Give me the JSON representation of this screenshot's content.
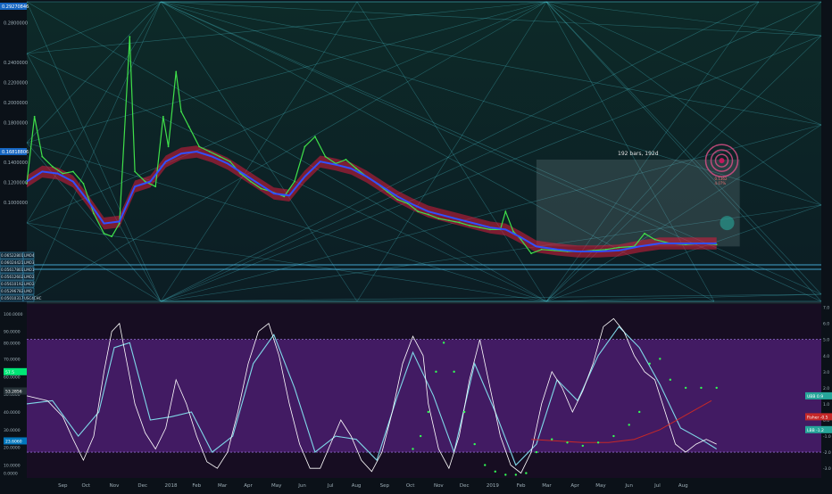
{
  "chart_data": [
    {
      "type": "line",
      "panel": "price",
      "ylim": [
        0.0,
        0.3
      ],
      "x_range": [
        0,
        300
      ],
      "price_tags": {
        "top_label": "0.29270846",
        "mid_label": "0.16818806",
        "low_labels": [
          {
            "value": 0.0652,
            "text": "0.06522801"
          },
          {
            "value": 0.0602,
            "text": "0.06024421"
          },
          {
            "value": 0.0561,
            "text": "0.05617801"
          },
          {
            "value": 0.0525,
            "text": "0.05612602"
          },
          {
            "value": 0.0488,
            "text": "0.05610192"
          },
          {
            "value": 0.0452,
            "text": "0.05296782"
          },
          {
            "value": 0.0405,
            "text": "0.05010317"
          }
        ],
        "low_tags": [
          "LMO4",
          "LMO3",
          "LMO1",
          "LMO2",
          "LMO2",
          "LMO",
          "USC4CHC"
        ]
      },
      "yaxis_labels": [
        {
          "value": 0.28,
          "text": "0.2800000"
        },
        {
          "value": 0.24,
          "text": "0.2400000"
        },
        {
          "value": 0.22,
          "text": "0.2200000"
        },
        {
          "value": 0.2,
          "text": "0.2000000"
        },
        {
          "value": 0.18,
          "text": "0.1800000"
        },
        {
          "value": 0.14,
          "text": "0.1400000"
        },
        {
          "value": 0.12,
          "text": "0.1200000"
        },
        {
          "value": 0.1,
          "text": "0.1000000"
        }
      ],
      "measure_box": {
        "x0": 198,
        "x1": 277,
        "y0": 0.055,
        "y1": 0.142,
        "label": "192 bars, 192d"
      },
      "target_circle": {
        "x": 270,
        "y": 0.141,
        "label1": "0.1362",
        "label2": "4.07%"
      },
      "price_series": [
        [
          0,
          0.118
        ],
        [
          3,
          0.185
        ],
        [
          6,
          0.145
        ],
        [
          10,
          0.135
        ],
        [
          14,
          0.128
        ],
        [
          18,
          0.13
        ],
        [
          22,
          0.118
        ],
        [
          26,
          0.088
        ],
        [
          30,
          0.068
        ],
        [
          33,
          0.065
        ],
        [
          36,
          0.078
        ],
        [
          40,
          0.265
        ],
        [
          42,
          0.13
        ],
        [
          46,
          0.12
        ],
        [
          50,
          0.115
        ],
        [
          53,
          0.185
        ],
        [
          55,
          0.155
        ],
        [
          58,
          0.23
        ],
        [
          60,
          0.19
        ],
        [
          63,
          0.175
        ],
        [
          67,
          0.155
        ],
        [
          71,
          0.15
        ],
        [
          75,
          0.145
        ],
        [
          79,
          0.14
        ],
        [
          83,
          0.128
        ],
        [
          87,
          0.12
        ],
        [
          91,
          0.113
        ],
        [
          95,
          0.11
        ],
        [
          100,
          0.105
        ],
        [
          104,
          0.12
        ],
        [
          108,
          0.155
        ],
        [
          112,
          0.165
        ],
        [
          116,
          0.145
        ],
        [
          120,
          0.138
        ],
        [
          124,
          0.142
        ],
        [
          128,
          0.133
        ],
        [
          132,
          0.125
        ],
        [
          136,
          0.118
        ],
        [
          140,
          0.11
        ],
        [
          144,
          0.102
        ],
        [
          148,
          0.098
        ],
        [
          152,
          0.09
        ],
        [
          156,
          0.087
        ],
        [
          160,
          0.083
        ],
        [
          164,
          0.081
        ],
        [
          168,
          0.079
        ],
        [
          172,
          0.076
        ],
        [
          176,
          0.074
        ],
        [
          180,
          0.072
        ],
        [
          184,
          0.072
        ],
        [
          186,
          0.09
        ],
        [
          189,
          0.07
        ],
        [
          192,
          0.062
        ],
        [
          196,
          0.048
        ],
        [
          200,
          0.052
        ],
        [
          205,
          0.051
        ],
        [
          210,
          0.05
        ],
        [
          215,
          0.05
        ],
        [
          220,
          0.051
        ],
        [
          225,
          0.052
        ],
        [
          230,
          0.054
        ],
        [
          236,
          0.055
        ],
        [
          240,
          0.068
        ],
        [
          244,
          0.062
        ],
        [
          250,
          0.058
        ],
        [
          256,
          0.057
        ],
        [
          262,
          0.058
        ],
        [
          268,
          0.057
        ]
      ],
      "ma_series": [
        [
          0,
          0.12
        ],
        [
          6,
          0.13
        ],
        [
          12,
          0.128
        ],
        [
          18,
          0.12
        ],
        [
          24,
          0.1
        ],
        [
          30,
          0.078
        ],
        [
          36,
          0.08
        ],
        [
          42,
          0.115
        ],
        [
          48,
          0.12
        ],
        [
          54,
          0.14
        ],
        [
          60,
          0.148
        ],
        [
          66,
          0.15
        ],
        [
          72,
          0.145
        ],
        [
          78,
          0.138
        ],
        [
          84,
          0.128
        ],
        [
          90,
          0.118
        ],
        [
          96,
          0.108
        ],
        [
          102,
          0.106
        ],
        [
          108,
          0.125
        ],
        [
          114,
          0.14
        ],
        [
          120,
          0.137
        ],
        [
          126,
          0.133
        ],
        [
          132,
          0.125
        ],
        [
          138,
          0.115
        ],
        [
          144,
          0.105
        ],
        [
          150,
          0.097
        ],
        [
          156,
          0.09
        ],
        [
          162,
          0.086
        ],
        [
          168,
          0.082
        ],
        [
          174,
          0.078
        ],
        [
          180,
          0.074
        ],
        [
          186,
          0.072
        ],
        [
          192,
          0.064
        ],
        [
          198,
          0.055
        ],
        [
          206,
          0.052
        ],
        [
          214,
          0.05
        ],
        [
          222,
          0.05
        ],
        [
          230,
          0.051
        ],
        [
          238,
          0.055
        ],
        [
          246,
          0.058
        ],
        [
          254,
          0.058
        ],
        [
          262,
          0.058
        ],
        [
          268,
          0.058
        ]
      ]
    },
    {
      "type": "line",
      "panel": "oscillator",
      "ylim": [
        -3.6,
        7.2
      ],
      "x_range": [
        0,
        300
      ],
      "left_axis": [
        {
          "value": 6.6,
          "text": "100.0000"
        },
        {
          "value": 5.5,
          "text": "90.0000"
        },
        {
          "value": 4.8,
          "text": "80.0000"
        },
        {
          "value": 3.8,
          "text": "70.0000"
        },
        {
          "value": 2.7,
          "text": "60.0000"
        },
        {
          "value": 1.6,
          "text": "50.0000"
        },
        {
          "value": 0.5,
          "text": "40.0000"
        },
        {
          "value": -0.6,
          "text": "30.0000"
        },
        {
          "value": -1.7,
          "text": "20.0000"
        },
        {
          "value": -2.8,
          "text": "10.0000"
        },
        {
          "value": -3.3,
          "text": "0.0000"
        }
      ],
      "right_axis": [
        {
          "value": 7.0,
          "text": "7.0"
        },
        {
          "value": 6.0,
          "text": "6.0"
        },
        {
          "value": 5.0,
          "text": "5.0"
        },
        {
          "value": 4.0,
          "text": "4.0"
        },
        {
          "value": 3.0,
          "text": "3.0"
        },
        {
          "value": 2.0,
          "text": "2.0"
        },
        {
          "value": 1.0,
          "text": "1.0"
        },
        {
          "value": 0.0,
          "text": "0.0"
        },
        {
          "value": -1.0,
          "text": "-1.0"
        },
        {
          "value": -2.0,
          "text": "-2.0"
        },
        {
          "value": -3.0,
          "text": "-3.0"
        }
      ],
      "band_upper": 5.0,
      "band_lower": -2.0,
      "tags_right": [
        {
          "value": 1.5,
          "text": "UBB 0.9",
          "color": "#26a69a"
        },
        {
          "value": 0.2,
          "text": "Fisher -0.5",
          "color": "#c62828"
        },
        {
          "value": -0.6,
          "text": "LBB -1.2",
          "color": "#26a69a"
        }
      ],
      "tags_left": [
        {
          "value": 3.0,
          "text": "57.5",
          "color": "#00e676"
        },
        {
          "value": 1.8,
          "text": "53.2856",
          "color": "#263238"
        },
        {
          "value": -1.3,
          "text": "23.6060",
          "color": "#0277bd"
        }
      ],
      "osc_series": [
        [
          0,
          1.5
        ],
        [
          8,
          1.2
        ],
        [
          14,
          0.2
        ],
        [
          18,
          -1.2
        ],
        [
          22,
          -2.5
        ],
        [
          26,
          -1.0
        ],
        [
          30,
          3.0
        ],
        [
          33,
          5.5
        ],
        [
          36,
          6.0
        ],
        [
          39,
          3.5
        ],
        [
          42,
          1.0
        ],
        [
          46,
          -0.8
        ],
        [
          50,
          -1.8
        ],
        [
          54,
          -0.5
        ],
        [
          58,
          2.5
        ],
        [
          62,
          1.0
        ],
        [
          66,
          -1.0
        ],
        [
          70,
          -2.6
        ],
        [
          74,
          -3.0
        ],
        [
          78,
          -2.0
        ],
        [
          82,
          0.5
        ],
        [
          86,
          3.5
        ],
        [
          90,
          5.5
        ],
        [
          94,
          6.0
        ],
        [
          98,
          4.0
        ],
        [
          102,
          1.0
        ],
        [
          106,
          -1.5
        ],
        [
          110,
          -3.0
        ],
        [
          114,
          -3.0
        ],
        [
          118,
          -1.5
        ],
        [
          122,
          0.0
        ],
        [
          126,
          -1.0
        ],
        [
          130,
          -2.5
        ],
        [
          134,
          -3.2
        ],
        [
          138,
          -2.0
        ],
        [
          142,
          0.5
        ],
        [
          146,
          3.5
        ],
        [
          150,
          5.2
        ],
        [
          154,
          4.0
        ],
        [
          156,
          1.0
        ],
        [
          160,
          -1.8
        ],
        [
          164,
          -3.0
        ],
        [
          168,
          -1.0
        ],
        [
          172,
          2.5
        ],
        [
          176,
          5.0
        ],
        [
          180,
          2.0
        ],
        [
          184,
          -1.0
        ],
        [
          188,
          -2.8
        ],
        [
          192,
          -3.3
        ],
        [
          196,
          -2.0
        ],
        [
          200,
          1.0
        ],
        [
          204,
          3.0
        ],
        [
          208,
          2.0
        ],
        [
          212,
          0.5
        ],
        [
          216,
          1.8
        ],
        [
          220,
          3.5
        ],
        [
          224,
          5.8
        ],
        [
          228,
          6.3
        ],
        [
          232,
          5.5
        ],
        [
          236,
          4.0
        ],
        [
          240,
          3.0
        ],
        [
          244,
          2.5
        ],
        [
          248,
          0.5
        ],
        [
          252,
          -1.5
        ],
        [
          256,
          -2.0
        ],
        [
          260,
          -1.5
        ],
        [
          264,
          -1.2
        ],
        [
          268,
          -1.5
        ]
      ],
      "signal_series": [
        [
          0,
          1.0
        ],
        [
          10,
          1.2
        ],
        [
          20,
          -1.0
        ],
        [
          28,
          0.5
        ],
        [
          34,
          4.5
        ],
        [
          40,
          4.8
        ],
        [
          48,
          0.0
        ],
        [
          56,
          0.2
        ],
        [
          64,
          0.5
        ],
        [
          72,
          -2.0
        ],
        [
          80,
          -1.0
        ],
        [
          88,
          3.5
        ],
        [
          96,
          5.3
        ],
        [
          104,
          2.0
        ],
        [
          112,
          -2.0
        ],
        [
          120,
          -1.0
        ],
        [
          128,
          -1.2
        ],
        [
          136,
          -2.5
        ],
        [
          144,
          1.5
        ],
        [
          150,
          4.2
        ],
        [
          158,
          1.5
        ],
        [
          166,
          -2.0
        ],
        [
          174,
          3.5
        ],
        [
          182,
          0.5
        ],
        [
          190,
          -2.8
        ],
        [
          198,
          -1.5
        ],
        [
          206,
          2.5
        ],
        [
          214,
          1.2
        ],
        [
          222,
          4.0
        ],
        [
          230,
          5.8
        ],
        [
          238,
          4.5
        ],
        [
          246,
          2.2
        ],
        [
          254,
          -0.5
        ],
        [
          262,
          -1.2
        ],
        [
          268,
          -1.8
        ]
      ],
      "dot_series": [
        [
          150,
          -1.8
        ],
        [
          153,
          -1.0
        ],
        [
          156,
          0.5
        ],
        [
          159,
          3.0
        ],
        [
          162,
          4.8
        ],
        [
          166,
          3.0
        ],
        [
          170,
          0.5
        ],
        [
          174,
          -1.5
        ],
        [
          178,
          -2.8
        ],
        [
          182,
          -3.2
        ],
        [
          186,
          -3.4
        ],
        [
          190,
          -3.4
        ],
        [
          194,
          -3.3
        ],
        [
          198,
          -2.0
        ],
        [
          204,
          -1.2
        ],
        [
          210,
          -1.4
        ],
        [
          216,
          -1.6
        ],
        [
          222,
          -1.4
        ],
        [
          228,
          -1.0
        ],
        [
          234,
          -0.3
        ],
        [
          238,
          0.5
        ],
        [
          242,
          3.5
        ],
        [
          246,
          3.8
        ],
        [
          250,
          2.5
        ],
        [
          256,
          2.0
        ],
        [
          262,
          2.0
        ],
        [
          268,
          2.0
        ]
      ],
      "curve_series": [
        [
          196,
          -1.2
        ],
        [
          206,
          -1.3
        ],
        [
          216,
          -1.4
        ],
        [
          226,
          -1.4
        ],
        [
          236,
          -1.2
        ],
        [
          246,
          -0.6
        ],
        [
          256,
          0.3
        ],
        [
          266,
          1.2
        ]
      ]
    }
  ],
  "xaxis": {
    "ticks": [
      {
        "x": 14,
        "text": "Sep"
      },
      {
        "x": 23,
        "text": "Oct"
      },
      {
        "x": 34,
        "text": "Nov"
      },
      {
        "x": 45,
        "text": "Dec"
      },
      {
        "x": 56,
        "text": "2018"
      },
      {
        "x": 66,
        "text": "Feb"
      },
      {
        "x": 76,
        "text": "Mar"
      },
      {
        "x": 86,
        "text": "Apr"
      },
      {
        "x": 97,
        "text": "May"
      },
      {
        "x": 107,
        "text": "Jun"
      },
      {
        "x": 118,
        "text": "Jul"
      },
      {
        "x": 128,
        "text": "Aug"
      },
      {
        "x": 139,
        "text": "Sep"
      },
      {
        "x": 149,
        "text": "Oct"
      },
      {
        "x": 160,
        "text": "Nov"
      },
      {
        "x": 170,
        "text": "Dec"
      },
      {
        "x": 181,
        "text": "2019"
      },
      {
        "x": 192,
        "text": "Feb"
      },
      {
        "x": 202,
        "text": "Mar"
      },
      {
        "x": 213,
        "text": "Apr"
      },
      {
        "x": 223,
        "text": "May"
      },
      {
        "x": 234,
        "text": "Jun"
      },
      {
        "x": 245,
        "text": "Jul"
      },
      {
        "x": 255,
        "text": "Aug"
      }
    ]
  },
  "colors": {
    "bg_top": "#0e2a2a",
    "bg_osc": "#4a1e6e",
    "price": "#3fe04a",
    "ma": "#3050ff",
    "ribbon_red": "#d81b3c",
    "grid_line": "#4fd4e0",
    "osc_line": "#ffffff",
    "signal": "#7fd8e8",
    "dots": "#33ff55",
    "curve": "#c62828"
  }
}
